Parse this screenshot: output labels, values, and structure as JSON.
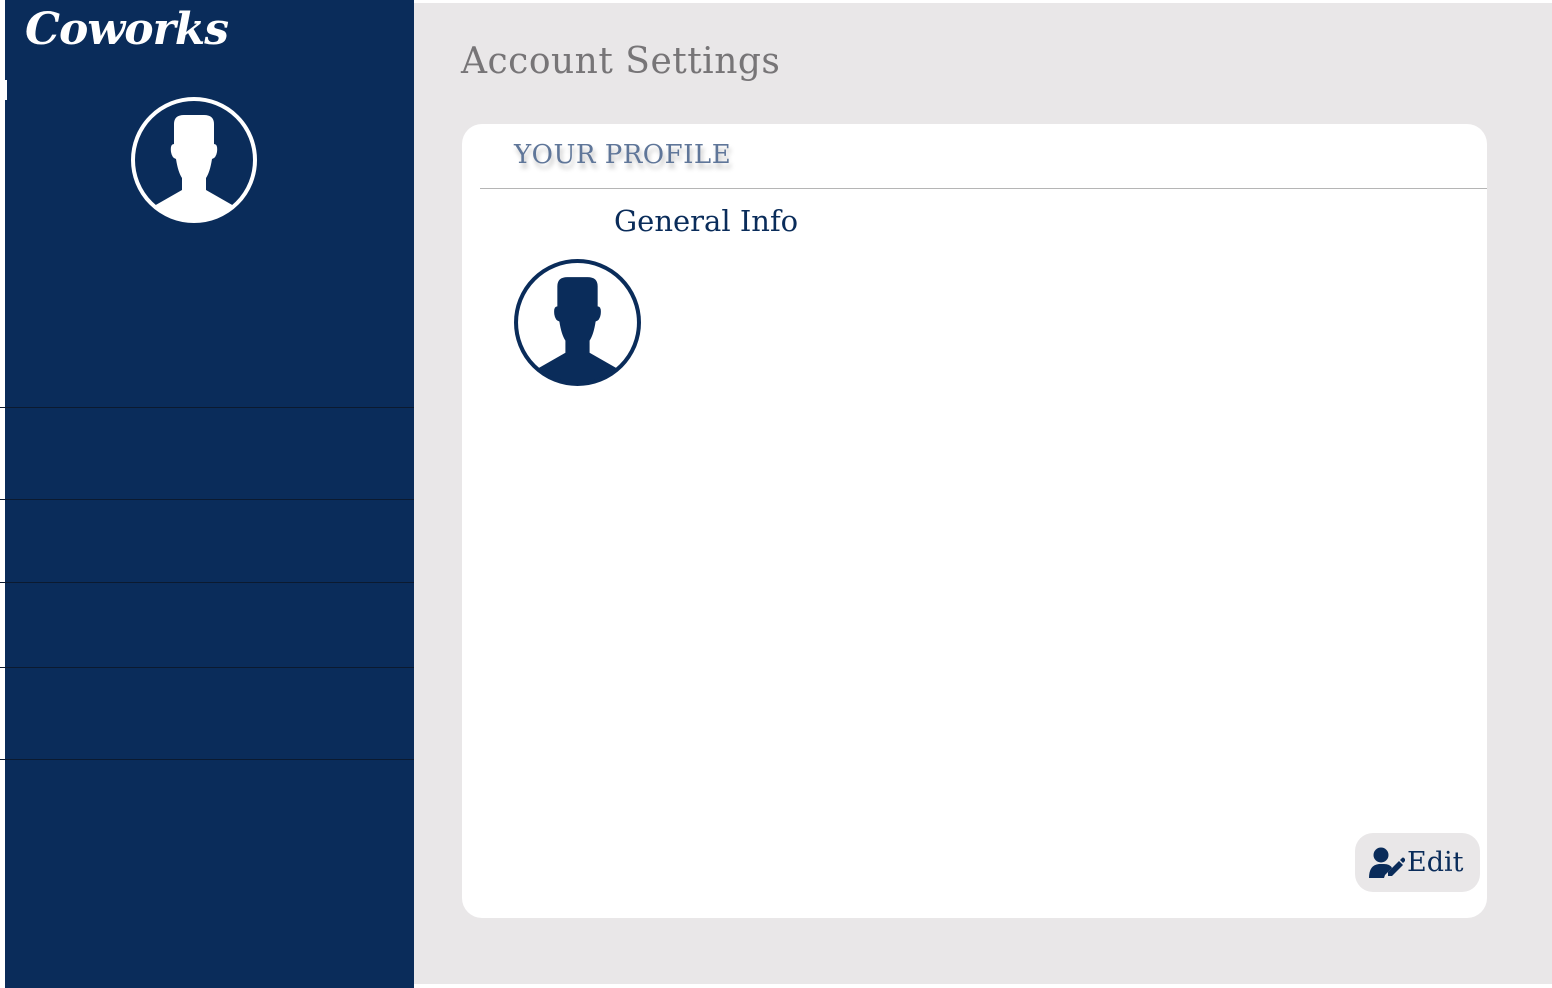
{
  "app": {
    "logo_text": "Coworks"
  },
  "sidebar": {
    "avatar_icon": "user-silhouette-icon",
    "nav_items": [
      "",
      "",
      "",
      ""
    ]
  },
  "main": {
    "page_title": "Account Settings",
    "profile_card": {
      "heading": "YOUR PROFILE",
      "section_title": "General Info",
      "avatar_icon": "user-silhouette-icon",
      "edit_button_label": "Edit",
      "edit_icon": "user-edit-icon"
    }
  },
  "colors": {
    "sidebar_bg": "#0a2c5a",
    "main_bg": "#e9e7e8",
    "card_bg": "#ffffff",
    "accent": "#0a2c5a",
    "title_gray": "#777577",
    "heading_blue": "#5f7699"
  }
}
